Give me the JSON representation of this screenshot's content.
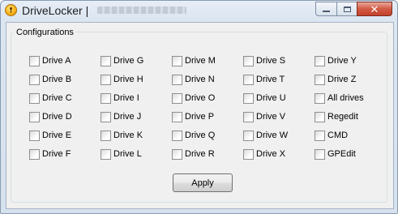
{
  "window": {
    "title": "DriveLocker |",
    "icon": "padlock-icon",
    "close_glyph": "✕"
  },
  "group": {
    "label": "Configurations"
  },
  "checkboxes": [
    [
      "Drive A",
      "Drive B",
      "Drive C",
      "Drive D",
      "Drive E",
      "Drive F"
    ],
    [
      "Drive G",
      "Drive H",
      "Drive I",
      "Drive J",
      "Drive K",
      "Drive L"
    ],
    [
      "Drive M",
      "Drive N",
      "Drive O",
      "Drive P",
      "Drive Q",
      "Drive R"
    ],
    [
      "Drive S",
      "Drive T",
      "Drive U",
      "Drive V",
      "Drive W",
      "Drive X"
    ],
    [
      "Drive Y",
      "Drive Z",
      "All drives",
      "Regedit",
      "CMD",
      "GPEdit"
    ]
  ],
  "apply_button": {
    "label": "Apply"
  },
  "colors": {
    "close_button": "#c4412b",
    "client_background": "#f0f0f0"
  }
}
